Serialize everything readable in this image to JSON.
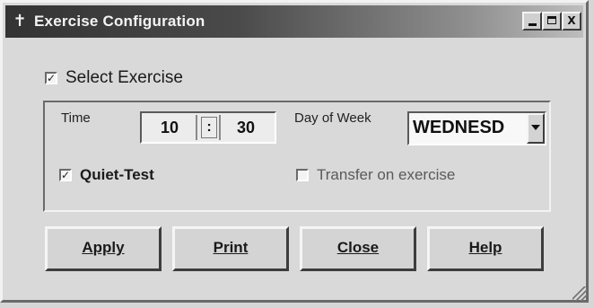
{
  "window": {
    "title": "Exercise Configuration",
    "title_icon": "cross-icon"
  },
  "titlebar_buttons": {
    "close_glyph": "X"
  },
  "select_exercise": {
    "label": "Select Exercise",
    "checked": true
  },
  "time": {
    "label": "Time",
    "hour": "10",
    "separator": ":",
    "minute": "30"
  },
  "day_of_week": {
    "label": "Day of Week",
    "value": "WEDNESD"
  },
  "quiet_test": {
    "label": "Quiet-Test",
    "checked": true
  },
  "transfer": {
    "label": "Transfer on exercise",
    "checked": false
  },
  "buttons": {
    "apply": "Apply",
    "print": "Print",
    "close": "Close",
    "help": "Help"
  }
}
